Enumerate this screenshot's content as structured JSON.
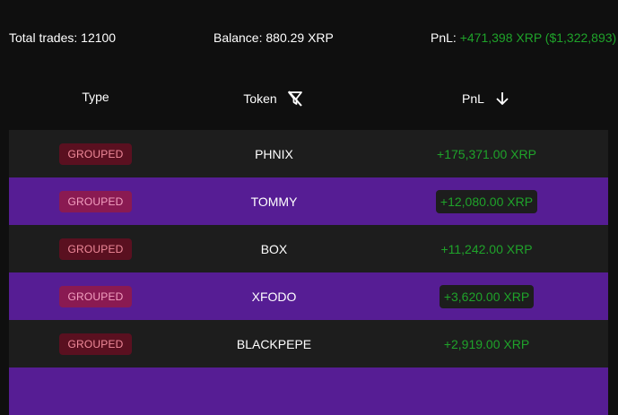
{
  "summary": {
    "total_trades": "Total trades: 12100",
    "balance": "Balance: 880.29 XRP",
    "pnl_label": "PnL:",
    "pnl_value": "+471,398 XRP ($1,322,893)"
  },
  "table": {
    "headers": {
      "type": "Type",
      "token": "Token",
      "pnl": "PnL"
    },
    "icons": {
      "token_filter": "filter-off-icon",
      "pnl_sort": "arrow-down-icon"
    },
    "rows": [
      {
        "type": "GROUPED",
        "token": "PHNIX",
        "pnl": "+175,371.00 XRP"
      },
      {
        "type": "GROUPED",
        "token": "TOMMY",
        "pnl": "+12,080.00 XRP"
      },
      {
        "type": "GROUPED",
        "token": "BOX",
        "pnl": "+11,242.00 XRP"
      },
      {
        "type": "GROUPED",
        "token": "XFODO",
        "pnl": "+3,620.00 XRP"
      },
      {
        "type": "GROUPED",
        "token": "BLACKPEPE",
        "pnl": "+2,919.00 XRP"
      }
    ]
  },
  "colors": {
    "background": "#0f0f0f",
    "row_dark": "#1d1d1d",
    "row_purple": "#561d94",
    "positive": "#1fa32a",
    "badge_bg": "#5a1020",
    "badge_text": "#f08a9a"
  }
}
